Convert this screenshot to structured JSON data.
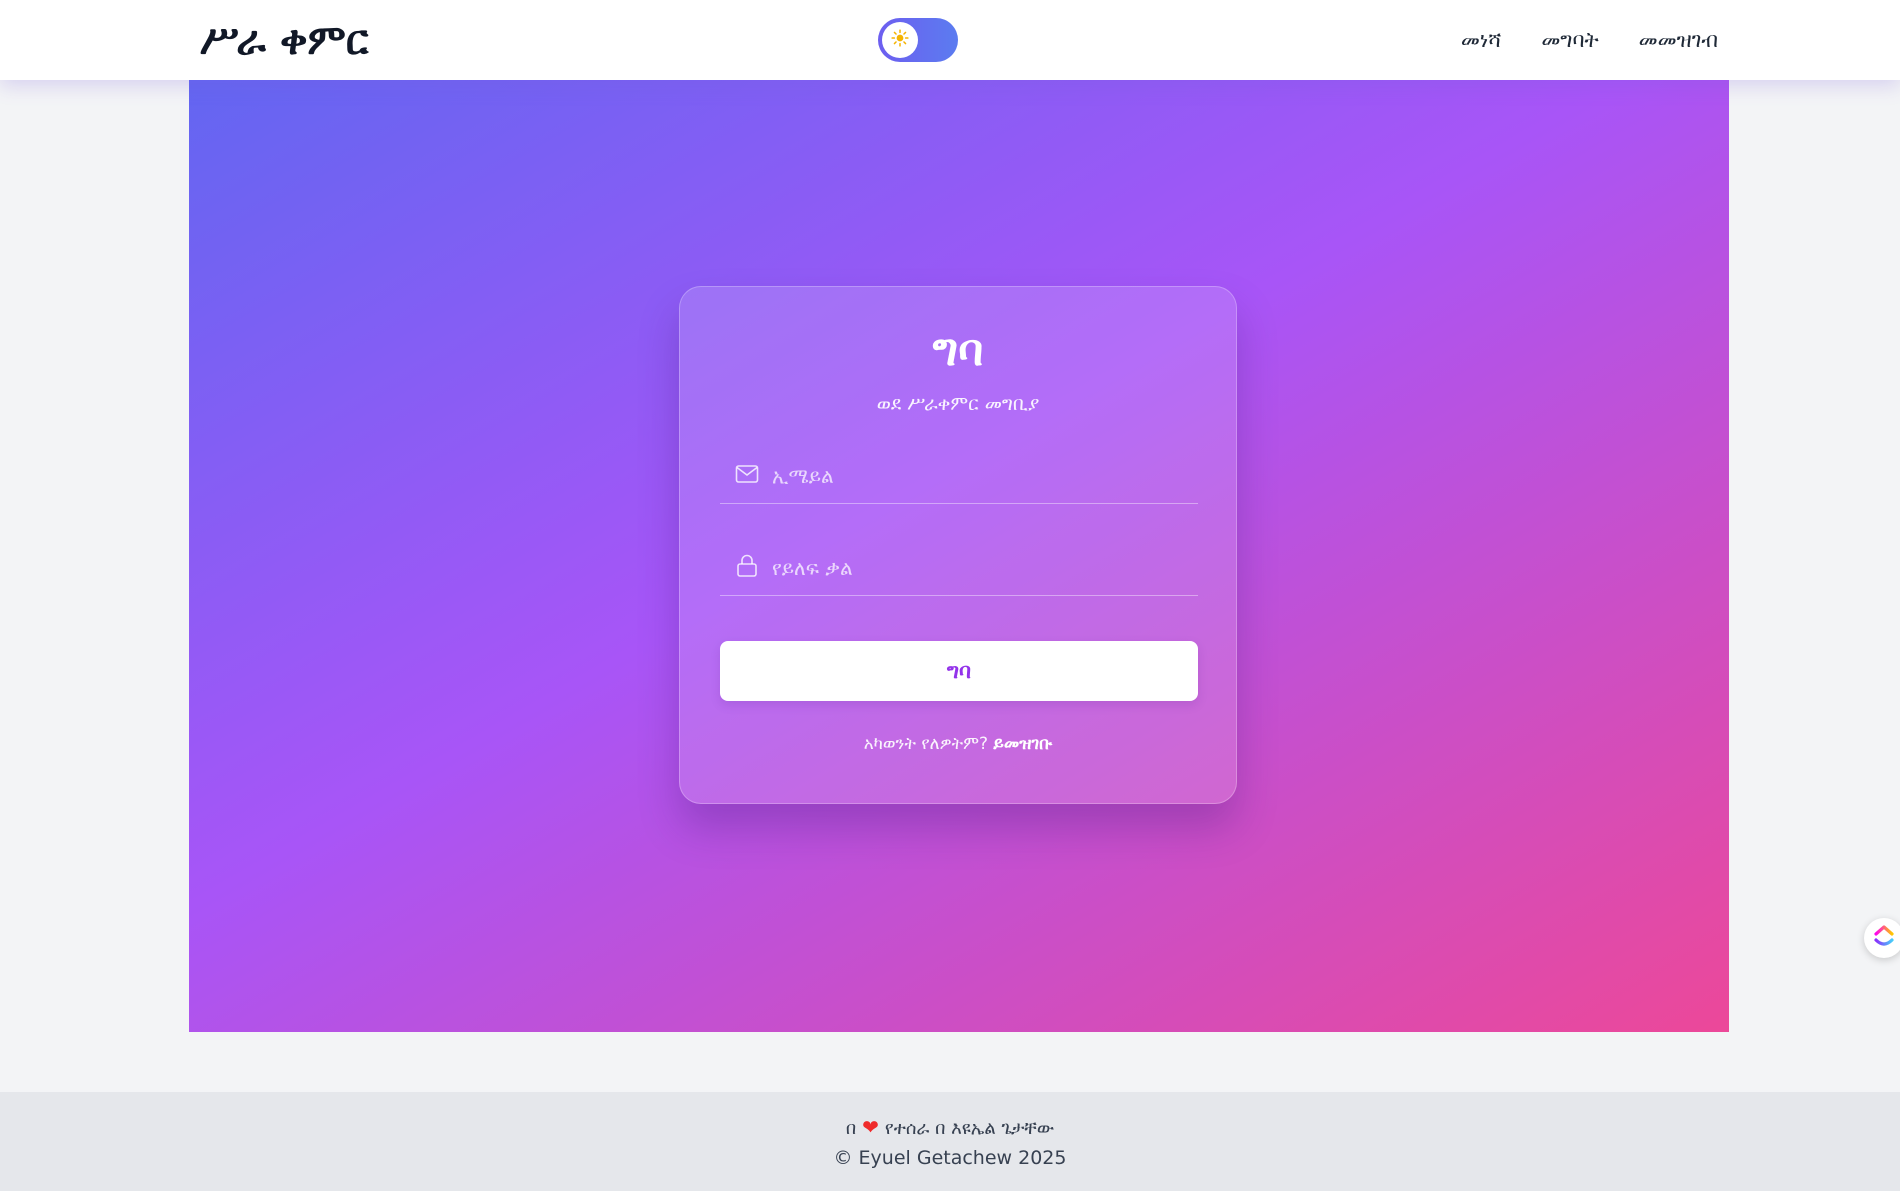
{
  "navbar": {
    "brand": "ሥራ ቀምር",
    "links": [
      "መነሻ",
      "መግባት",
      "መመዝገብ"
    ]
  },
  "theme_toggle": {
    "icon": "sun-icon",
    "state": "light"
  },
  "login_card": {
    "title": "ግባ",
    "subtitle": "ወደ ሥራቀምር መግቢያ",
    "email": {
      "placeholder": "ኢሜይል",
      "value": "",
      "icon": "mail-icon"
    },
    "password": {
      "placeholder": "የይለፍ ቃል",
      "value": "",
      "icon": "lock-icon"
    },
    "submit_label": "ግባ",
    "register_prompt": "አካወንት የለዎትም?",
    "register_link": "ይመዝገቡ"
  },
  "footer": {
    "made_with_prefix": "በ",
    "heart": "❤",
    "made_with_suffix": "የተሰራ በ እዩኤል ጌታቸው",
    "copyright": "© Eyuel Getachew 2025"
  },
  "floating_widget": {
    "icon": "clickup-logo-icon"
  },
  "colors": {
    "gradient_start": "#6366f1",
    "gradient_mid": "#a855f7",
    "gradient_end": "#ec4899",
    "button_text": "#9333ea",
    "heart": "#ef2b2b"
  }
}
